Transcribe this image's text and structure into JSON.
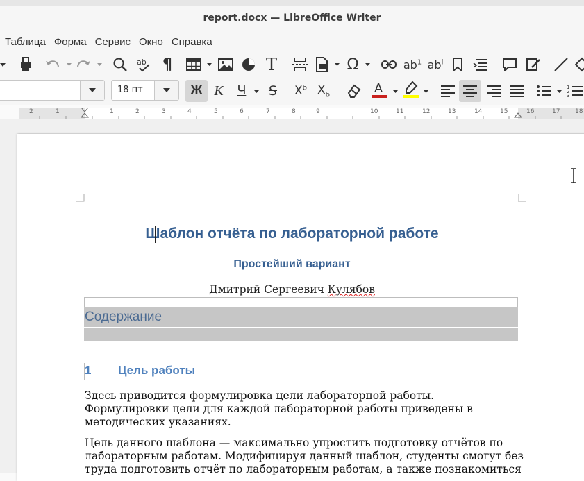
{
  "window": {
    "title": "report.docx — LibreOffice Writer"
  },
  "menu": {
    "items": [
      "Таблица",
      "Форма",
      "Сервис",
      "Окно",
      "Справка"
    ]
  },
  "formatting": {
    "font_size": "18 пт",
    "bold_label": "Ж",
    "italic_label": "К",
    "underline_label": "Ч"
  },
  "ruler": {
    "labels": [
      "2",
      "1",
      "1",
      "2",
      "3",
      "4",
      "5",
      "6",
      "7",
      "8",
      "9",
      "10",
      "11",
      "12",
      "13",
      "14",
      "15",
      "16",
      "17",
      "18"
    ]
  },
  "document": {
    "title": "Шаблон отчёта по лабораторной работе",
    "subtitle": "Простейший вариант",
    "author_first": "Дмитрий Сергеевич ",
    "author_last": "Кулябов",
    "toc_heading": "Содержание",
    "section_number": "1",
    "section_title": "Цель работы",
    "para1": [
      "Здесь приводится формулировка цели лабораторной работы.",
      "Формулировки цели для каждой лабораторной работы приведены в",
      "методических указаниях."
    ],
    "para2": [
      "Цель данного шаблона — максимально упростить подготовку отчётов по",
      "лабораторным работам. Модифицируя данный шаблон, студенты смогут без",
      "труда подготовить отчёт по лабораторным работам, а также познакомиться"
    ]
  },
  "colors": {
    "heading": "#365f91",
    "section": "#4f81bd",
    "font_color": "#c9211e",
    "highlight": "#ffff00"
  }
}
